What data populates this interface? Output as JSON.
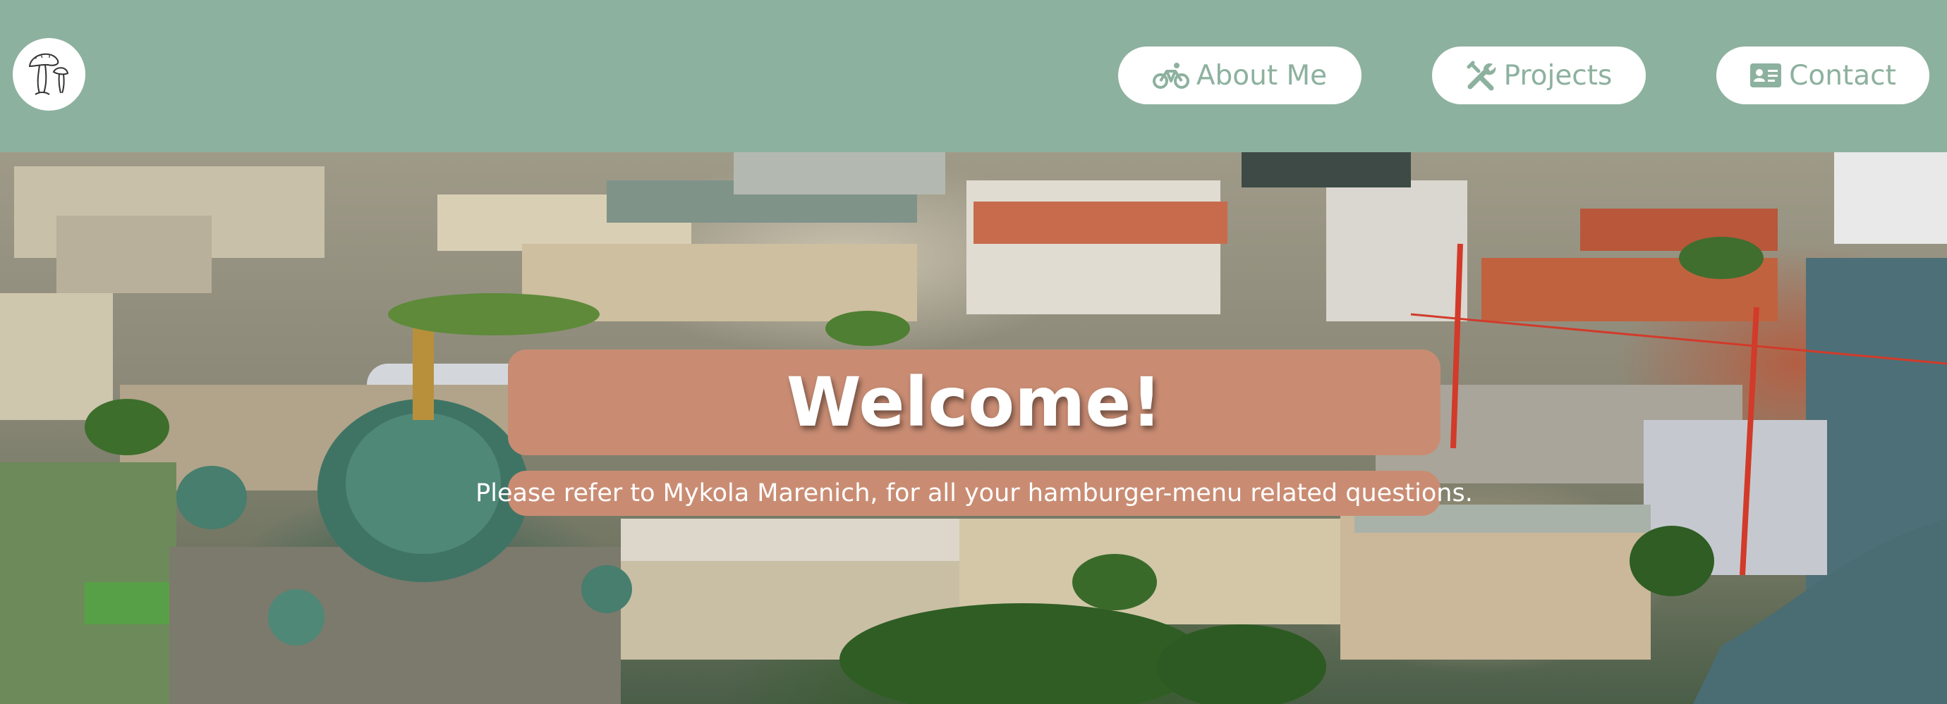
{
  "nav": {
    "logo_icon": "mushroom-sketch-icon",
    "items": [
      {
        "label": "About Me",
        "icon": "bicycle-icon"
      },
      {
        "label": "Projects",
        "icon": "tools-icon"
      },
      {
        "label": "Contact",
        "icon": "id-card-icon"
      }
    ]
  },
  "hero": {
    "title": "Welcome!",
    "subtitle": "Please refer to Mykola Marenich, for all your hamburger-menu related questions."
  },
  "colors": {
    "header_bg": "#8db19f",
    "button_bg": "#ffffff",
    "button_text": "#8db19f",
    "banner_bg": "#c98c73",
    "banner_text": "#ffffff"
  }
}
